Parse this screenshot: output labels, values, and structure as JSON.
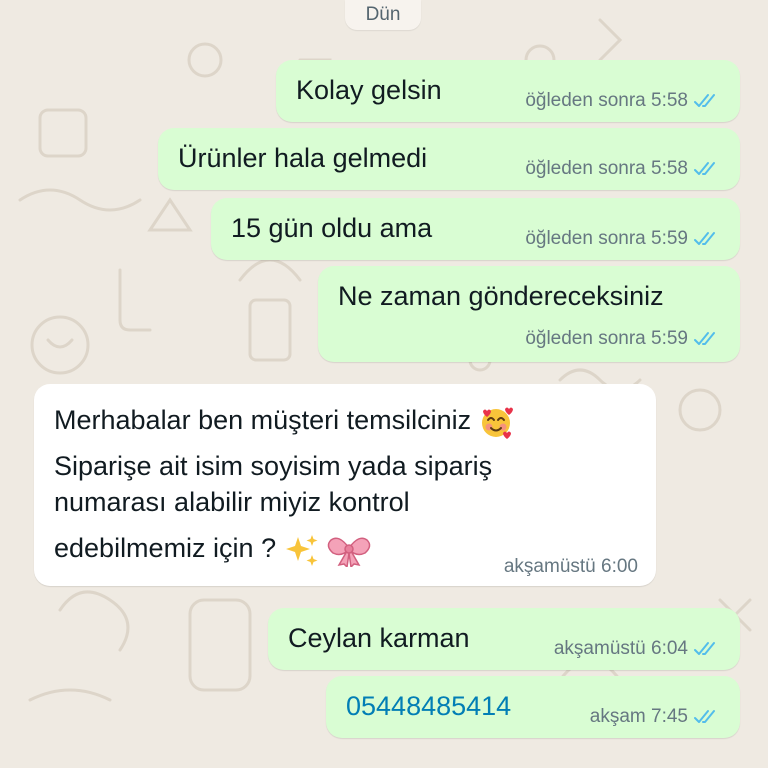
{
  "date_separator": "Dün",
  "colors": {
    "chat_background": "#efeae2",
    "outgoing_bubble": "#d9fdd3",
    "incoming_bubble": "#ffffff",
    "read_ticks": "#53bdeb",
    "link": "#027eb5",
    "meta_text": "#667781"
  },
  "messages": [
    {
      "direction": "outgoing",
      "text": "Kolay gelsin",
      "time": "öğleden sonra 5:58",
      "status": "read"
    },
    {
      "direction": "outgoing",
      "text": "Ürünler hala gelmedi",
      "time": "öğleden sonra 5:58",
      "status": "read"
    },
    {
      "direction": "outgoing",
      "text": "15 gün oldu ama",
      "time": "öğleden sonra 5:59",
      "status": "read"
    },
    {
      "direction": "outgoing",
      "text": "Ne zaman göndereceksiniz",
      "time": "öğleden sonra 5:59",
      "status": "read"
    },
    {
      "direction": "incoming",
      "lines": [
        "Merhabalar ben müşteri temsilciniz",
        "Siparişe ait isim soyisim yada sipariş",
        "numarası alabilir miyiz kontrol",
        "edebilmemiz için ?"
      ],
      "emojis": [
        "smiling-face-with-hearts",
        "sparkles",
        "ribbon"
      ],
      "time": "akşamüstü 6:00"
    },
    {
      "direction": "outgoing",
      "text": "Ceylan karman",
      "time": "akşamüstü 6:04",
      "status": "read"
    },
    {
      "direction": "outgoing",
      "text": "05448485414",
      "is_phone_link": true,
      "time": "akşam 7:45",
      "status": "read"
    }
  ]
}
